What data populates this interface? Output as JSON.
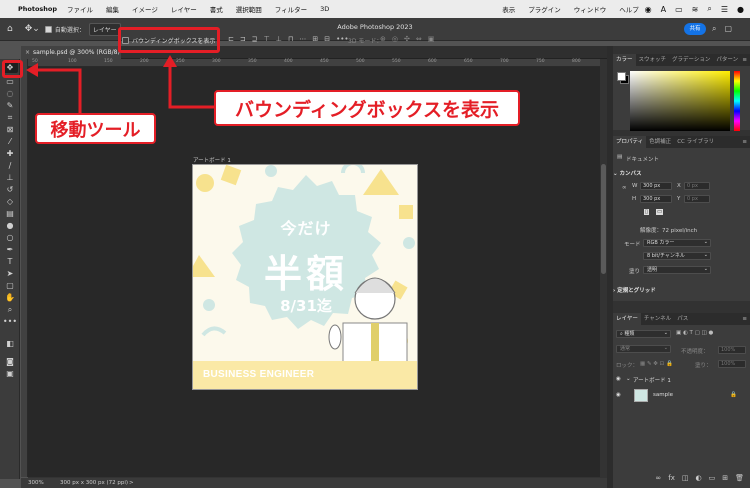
{
  "menubar": {
    "app": "Photoshop",
    "items": [
      "ファイル",
      "編集",
      "イメージ",
      "レイヤー",
      "書式",
      "選択範囲",
      "フィルター",
      "3D"
    ],
    "right_items": [
      "表示",
      "プラグイン",
      "ウィンドウ",
      "ヘルプ"
    ]
  },
  "window_title": "Adobe Photoshop 2023",
  "options_bar": {
    "auto_select_label": "自動選択：",
    "auto_select_target": "レイヤー",
    "bounding_box_label": "バウンディングボックスを表示",
    "mode_3d_label": "3D モード：",
    "share_label": "共有"
  },
  "document": {
    "tab_title": "sample.psd @ 300% (RGB/8)",
    "ruler_ticks": [
      "50",
      "100",
      "150",
      "200",
      "250",
      "300",
      "350",
      "400",
      "450",
      "500",
      "550",
      "600",
      "650",
      "700",
      "750",
      "800"
    ],
    "artboard_label": "アートボード 1",
    "artboard": {
      "line1": "今だけ",
      "line2": "半額",
      "line3": "8/31迄",
      "banner": "BUSINESS ENGINEER"
    }
  },
  "status": {
    "zoom": "300%",
    "info": "300 px x 300 px (72 ppi)",
    "arrow": ">"
  },
  "callouts": {
    "move_tool": "移動ツール",
    "bounding_box": "バウンディングボックスを表示"
  },
  "color_panel": {
    "tabs": [
      "カラー",
      "スウォッチ",
      "グラデーション",
      "パターン"
    ]
  },
  "properties_panel": {
    "tabs": [
      "プロパティ",
      "色調補正",
      "CC ライブラリ"
    ],
    "doc_label": "ドキュメント",
    "canvas_title": "カンバス",
    "w_label": "W",
    "w_value": "300 px",
    "h_label": "H",
    "h_value": "300 px",
    "x_label": "X",
    "x_value": "0 px",
    "y_label": "Y",
    "y_value": "0 px",
    "resolution": "解像度：72 pixel/inch",
    "mode_label": "モード",
    "mode_value": "RGB カラー",
    "bit_value": "8 bit/チャンネル",
    "fill_label": "塗り",
    "fill_value": "透明",
    "guides_title": "定規とグリッド"
  },
  "layers_panel": {
    "tabs": [
      "レイヤー",
      "チャンネル",
      "パス"
    ],
    "filter_kind": "種類",
    "blend_mode": "通常",
    "opacity_label": "不透明度：",
    "opacity_value": "100%",
    "lock_label": "ロック：",
    "fill_label": "塗り：",
    "fill_value": "100%",
    "artboard_layer": "アートボード 1",
    "sample_layer": "sample"
  }
}
